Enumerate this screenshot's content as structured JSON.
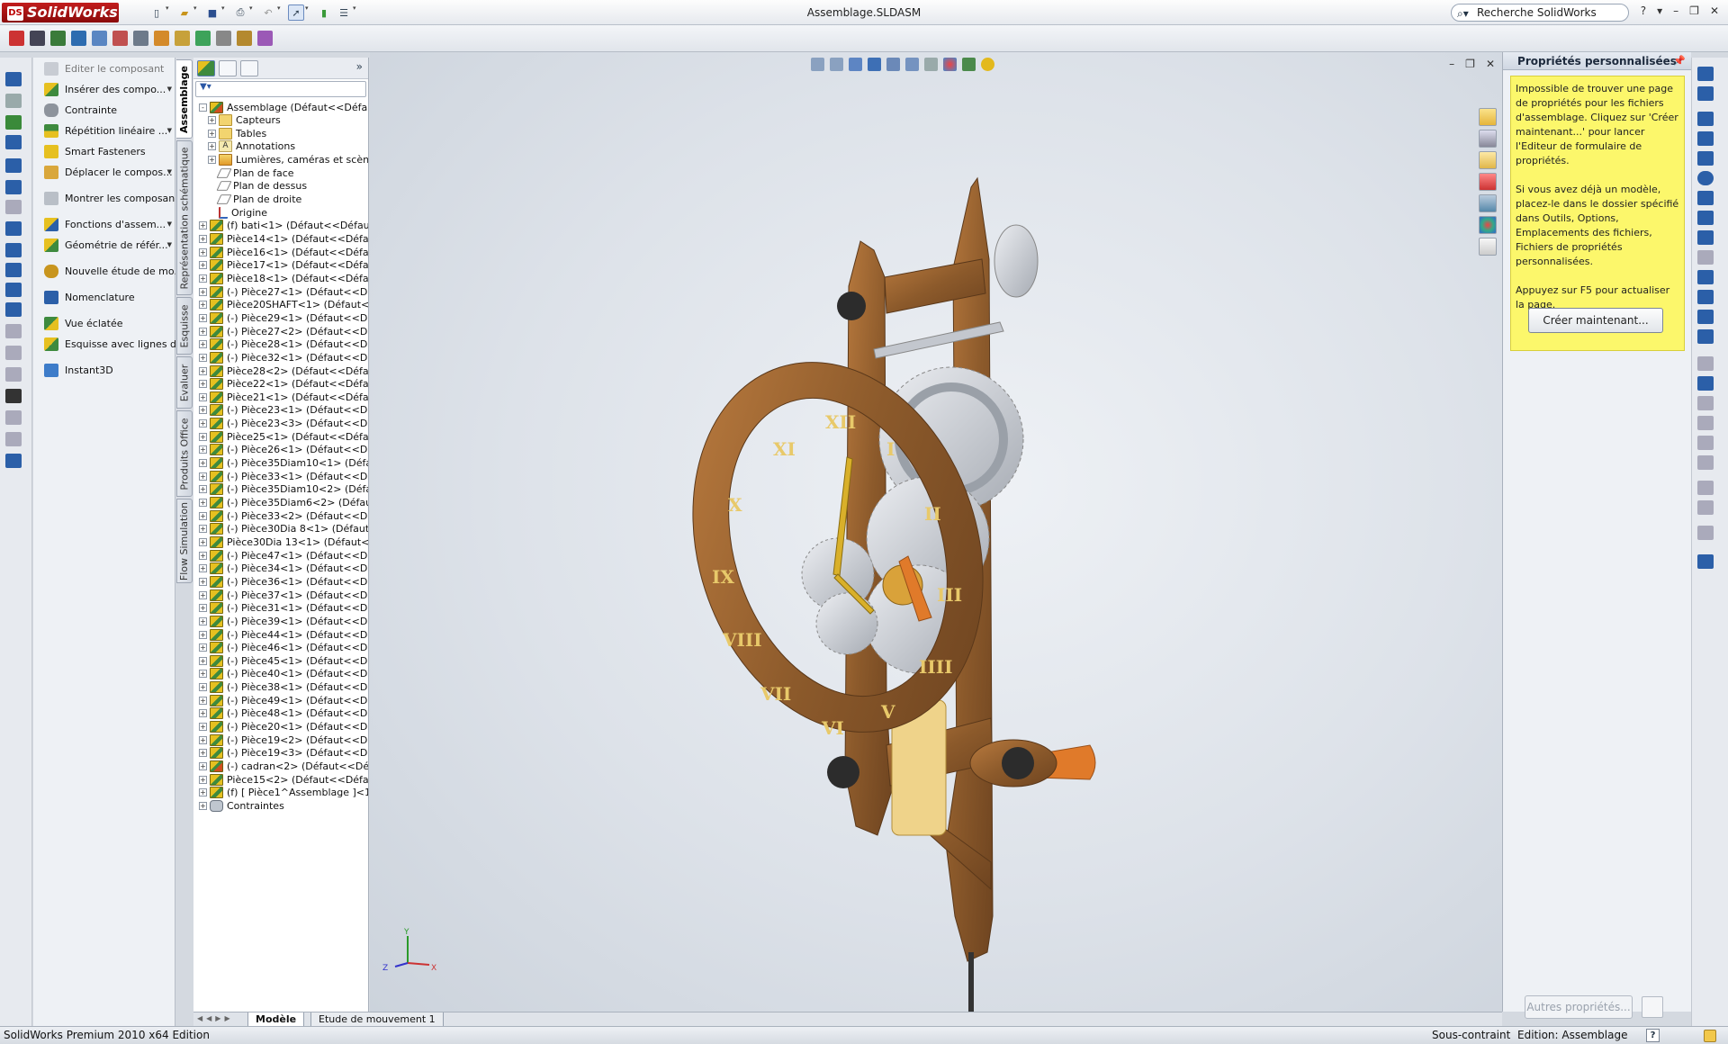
{
  "app": {
    "title": "Assemblage.SLDASM",
    "logo_text": "SolidWorks",
    "logo_mark": "DS",
    "search_placeholder": "Recherche SolidWorks",
    "window_buttons": [
      "?",
      "▾",
      "–",
      "❐",
      "✕"
    ]
  },
  "command_panel": {
    "items": [
      {
        "label": "Editer le composant",
        "icon": "edit-component-icon",
        "disabled": true
      },
      {
        "label": "Insérer des compo...",
        "icon": "insert-components-icon",
        "dropdown": true
      },
      {
        "label": "Contrainte",
        "icon": "mate-icon"
      },
      {
        "label": "Répétition linéaire ...",
        "icon": "linear-pattern-icon",
        "dropdown": true
      },
      {
        "label": "Smart Fasteners",
        "icon": "smart-fasteners-icon"
      },
      {
        "label": "Déplacer le compos...",
        "icon": "move-component-icon",
        "dropdown": true
      },
      {
        "label": "Montrer les composan...",
        "icon": "show-components-icon"
      },
      {
        "label": "Fonctions d'assem...",
        "icon": "assembly-features-icon",
        "dropdown": true
      },
      {
        "label": "Géométrie de référ...",
        "icon": "reference-geometry-icon",
        "dropdown": true
      },
      {
        "label": "Nouvelle étude de mo...",
        "icon": "new-motion-study-icon"
      },
      {
        "label": "Nomenclature",
        "icon": "bill-of-materials-icon"
      },
      {
        "label": "Vue éclatée",
        "icon": "exploded-view-icon"
      },
      {
        "label": "Esquisse avec lignes d...",
        "icon": "explode-line-sketch-icon"
      },
      {
        "label": "Instant3D",
        "icon": "instant3d-icon"
      }
    ]
  },
  "vertical_tabs": [
    "Assemblage",
    "Représentation schématique",
    "Esquisse",
    "Evaluer",
    "Produits Office",
    "Flow Simulation"
  ],
  "feature_tree": {
    "nodes": [
      {
        "label": "Assemblage  (Défaut<<Défaut>_",
        "icon": "asm",
        "expander": "-"
      },
      {
        "label": "Capteurs",
        "icon": "folder",
        "expander": "+"
      },
      {
        "label": "Tables",
        "icon": "folder",
        "expander": "+"
      },
      {
        "label": "Annotations",
        "icon": "annot",
        "expander": "+"
      },
      {
        "label": "Lumières, caméras et scène",
        "icon": "light",
        "expander": "+"
      },
      {
        "label": "Plan de face",
        "icon": "plane",
        "expander": ""
      },
      {
        "label": "Plan de dessus",
        "icon": "plane",
        "expander": ""
      },
      {
        "label": "Plan de droite",
        "icon": "plane",
        "expander": ""
      },
      {
        "label": "Origine",
        "icon": "origin",
        "expander": ""
      },
      {
        "label": "(f) bati<1> (Défaut<<Défaut",
        "icon": "part",
        "expander": "+"
      },
      {
        "label": "Pièce14<1> (Défaut<<Défau",
        "icon": "part",
        "expander": "+"
      },
      {
        "label": "Pièce16<1> (Défaut<<Défau",
        "icon": "part",
        "expander": "+"
      },
      {
        "label": "Pièce17<1> (Défaut<<Défau",
        "icon": "part",
        "expander": "+"
      },
      {
        "label": "Pièce18<1> (Défaut<<Défau",
        "icon": "part",
        "expander": "+"
      },
      {
        "label": "(-) Pièce27<1> (Défaut<<Dé",
        "icon": "part",
        "expander": "+"
      },
      {
        "label": "Pièce20SHAFT<1> (Défaut<",
        "icon": "part",
        "expander": "+"
      },
      {
        "label": "(-) Pièce29<1> (Défaut<<Dé",
        "icon": "part",
        "expander": "+"
      },
      {
        "label": "(-) Pièce27<2> (Défaut<<Dé",
        "icon": "part",
        "expander": "+"
      },
      {
        "label": "(-) Pièce28<1> (Défaut<<Dé",
        "icon": "part",
        "expander": "+"
      },
      {
        "label": "(-) Pièce32<1> (Défaut<<Dé",
        "icon": "part",
        "expander": "+"
      },
      {
        "label": "Pièce28<2> (Défaut<<Défau",
        "icon": "part",
        "expander": "+"
      },
      {
        "label": "Pièce22<1> (Défaut<<Défau",
        "icon": "part",
        "expander": "+"
      },
      {
        "label": "Pièce21<1> (Défaut<<Défau",
        "icon": "part",
        "expander": "+"
      },
      {
        "label": "(-) Pièce23<1> (Défaut<<Dé",
        "icon": "part",
        "expander": "+"
      },
      {
        "label": "(-) Pièce23<3> (Défaut<<Dé",
        "icon": "part",
        "expander": "+"
      },
      {
        "label": "Pièce25<1> (Défaut<<Défau",
        "icon": "part",
        "expander": "+"
      },
      {
        "label": "(-) Pièce26<1> (Défaut<<Dé",
        "icon": "part",
        "expander": "+"
      },
      {
        "label": "(-) Pièce35Diam10<1> (Défa",
        "icon": "part",
        "expander": "+"
      },
      {
        "label": "(-) Pièce33<1> (Défaut<<Dé",
        "icon": "part",
        "expander": "+"
      },
      {
        "label": "(-) Pièce35Diam10<2> (Défa",
        "icon": "part",
        "expander": "+"
      },
      {
        "label": "(-) Pièce35Diam6<2> (Défau",
        "icon": "part",
        "expander": "+"
      },
      {
        "label": "(-) Pièce33<2> (Défaut<<Dé",
        "icon": "part",
        "expander": "+"
      },
      {
        "label": "(-) Pièce30Dia 8<1> (Défaut<",
        "icon": "part",
        "expander": "+"
      },
      {
        "label": "Pièce30Dia 13<1> (Défaut<<",
        "icon": "part",
        "expander": "+"
      },
      {
        "label": "(-) Pièce47<1> (Défaut<<Dé",
        "icon": "part",
        "expander": "+"
      },
      {
        "label": "(-) Pièce34<1> (Défaut<<Dé",
        "icon": "part",
        "expander": "+"
      },
      {
        "label": "(-) Pièce36<1> (Défaut<<Dé",
        "icon": "part",
        "expander": "+"
      },
      {
        "label": "(-) Pièce37<1> (Défaut<<Dé",
        "icon": "part",
        "expander": "+"
      },
      {
        "label": "(-) Pièce31<1> (Défaut<<Dé",
        "icon": "part",
        "expander": "+"
      },
      {
        "label": "(-) Pièce39<1> (Défaut<<Dé",
        "icon": "part",
        "expander": "+"
      },
      {
        "label": "(-) Pièce44<1> (Défaut<<Dé",
        "icon": "part",
        "expander": "+"
      },
      {
        "label": "(-) Pièce46<1> (Défaut<<Dé",
        "icon": "part",
        "expander": "+"
      },
      {
        "label": "(-) Pièce45<1> (Défaut<<Dé",
        "icon": "part",
        "expander": "+"
      },
      {
        "label": "(-) Pièce40<1> (Défaut<<Dé",
        "icon": "part",
        "expander": "+"
      },
      {
        "label": "(-) Pièce38<1> (Défaut<<Dé",
        "icon": "part",
        "expander": "+"
      },
      {
        "label": "(-) Pièce49<1> (Défaut<<Dé",
        "icon": "part",
        "expander": "+"
      },
      {
        "label": "(-) Pièce48<1> (Défaut<<Dé",
        "icon": "part",
        "expander": "+"
      },
      {
        "label": "(-) Pièce20<1> (Défaut<<Dé",
        "icon": "part",
        "expander": "+"
      },
      {
        "label": "(-) Pièce19<2> (Défaut<<Dé",
        "icon": "part",
        "expander": "+"
      },
      {
        "label": "(-) Pièce19<3> (Défaut<<Dé",
        "icon": "part",
        "expander": "+"
      },
      {
        "label": "(-) cadran<2> (Défaut<<Déf",
        "icon": "asm",
        "expander": "+"
      },
      {
        "label": "Pièce15<2> (Défaut<<Défau",
        "icon": "part",
        "expander": "+"
      },
      {
        "label": "(f) [ Pièce1^Assemblage ]<1",
        "icon": "part",
        "expander": "+"
      },
      {
        "label": "Contraintes",
        "icon": "mates",
        "expander": "+"
      }
    ]
  },
  "viewport": {
    "clock_numerals": [
      "XII",
      "I",
      "II",
      "III",
      "IIII",
      "V",
      "VI",
      "VII",
      "VIII",
      "IX",
      "X",
      "XI"
    ],
    "axis_labels": {
      "x": "X",
      "y": "Y",
      "z": "Z"
    }
  },
  "task_pane": {
    "title": "Propriétés personnalisées",
    "note_paragraphs": [
      "Impossible de trouver une page de propriétés pour les fichiers d'assemblage. Cliquez sur 'Créer maintenant...' pour lancer l'Editeur de formulaire de propriétés.",
      "Si vous avez déjà un modèle, placez-le dans le dossier spécifié dans Outils, Options, Emplacements des fichiers, Fichiers de propriétés personnalisées.",
      "Appuyez sur F5 pour actualiser la page."
    ],
    "create_button": "Créer maintenant...",
    "other_props_button": "Autres propriétés..."
  },
  "bottom_tabs": [
    "Modèle",
    "Etude de mouvement 1"
  ],
  "status_bar": {
    "left": "SolidWorks Premium 2010 x64 Edition",
    "constraint": "Sous-contraint",
    "mode": "Edition: Assemblage",
    "help": "?"
  },
  "colors": {
    "accent": "#c21d1d",
    "wood": "#9a6530",
    "gear": "#c9ccd2",
    "note_bg": "#fcf76b"
  }
}
